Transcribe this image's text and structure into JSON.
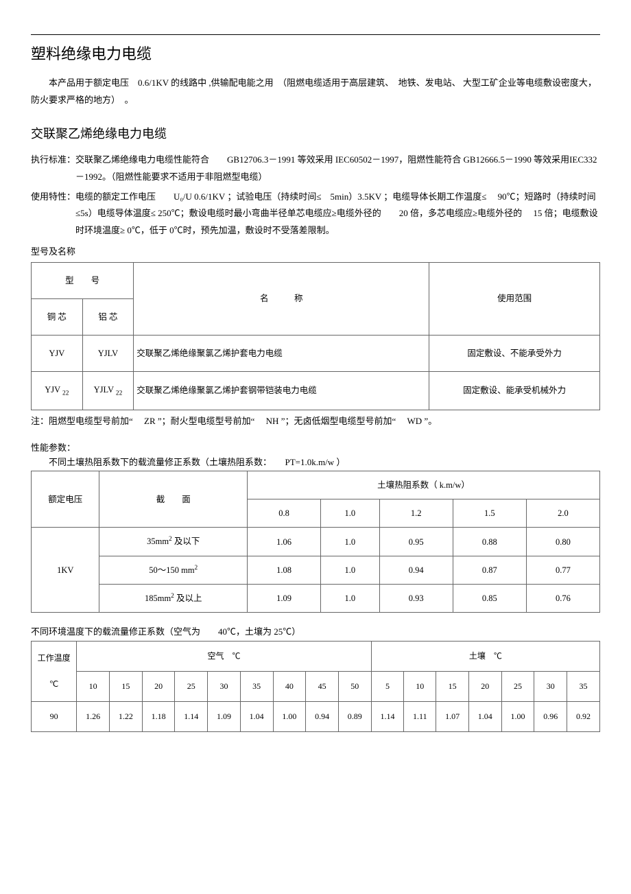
{
  "h1": "塑料绝缘电力电缆",
  "intro": "本产品用于额定电压　0.6/1KV 的线路中 ,供输配电能之用　（阻燃电缆适用于高层建筑、　地铁、发电站、 大型工矿企业等电缆敷设密度大，防火要求严格的地方）　。",
  "h2": "交联聚乙烯绝缘电力电缆",
  "std_label": "执行标准：",
  "std_body": "交联聚乙烯绝缘电力电缆性能符合　　GB12706.3－1991 等效采用  IEC60502－1997，阻燃性能符合   GB12666.5－1990 等效采用IEC332－1992。（阻燃性能要求不适用于非阻燃型电缆）",
  "use_label": "使用特性：",
  "use_body": "电缆的额定工作电压　　U₀/U 0.6/1KV ；试验电压（持续时间≤　5min）3.5KV ；电缆导体长期工作温度≤　 90℃；短路时（持续时间≤5s）电缆导体温度≤  250℃；敷设电缆时最小弯曲半径单芯电缆应≥电缆外径的　　20 倍，多芯电缆应≥电缆外径的　 15 倍；电缆敷设时环境温度≥  0℃，低于  0℃时，预先加温，敷设时不受落差限制。",
  "model_label": "型号及名称",
  "t1": {
    "h_model": "型　　号",
    "h_name": "名　　　称",
    "h_scope": "使用范围",
    "h_cu": "铜 芯",
    "h_al": "铝 芯",
    "rows": [
      {
        "cu": "YJV",
        "al": "YJLV",
        "name": "交联聚乙烯绝缘聚氯乙烯护套电力电缆",
        "scope": "固定敷设、不能承受外力"
      },
      {
        "cu": "YJV 22",
        "al": "YJLV 22",
        "name": "交联聚乙烯绝缘聚氯乙烯护套钢带铠装电力电缆",
        "scope": "固定敷设、能承受机械外力"
      }
    ]
  },
  "t1_note": "注：阻燃型电缆型号前加“　 ZR ”；耐火型电缆型号前加“　 NH ”；无卤低烟型电缆型号前加“　 WD ”。",
  "perf_label": "性能参数：",
  "t2_title": "不同土壤热阻系数下的载流量修正系数（土壤热阻系数：　　PT=1.0k.m/w ）",
  "t2": {
    "h_volt": "额定电压",
    "h_sec": "截　　面",
    "h_coef": "土壤热阻系数（  k.m/w）",
    "cols": [
      "0.8",
      "1.0",
      "1.2",
      "1.5",
      "2.0"
    ],
    "volt": "1KV",
    "rows": [
      {
        "sec": "35mm² 及以下",
        "v": [
          "1.06",
          "1.0",
          "0.95",
          "0.88",
          "0.80"
        ]
      },
      {
        "sec": "50～150 mm²",
        "v": [
          "1.08",
          "1.0",
          "0.94",
          "0.87",
          "0.77"
        ]
      },
      {
        "sec": "185mm² 及以上",
        "v": [
          "1.09",
          "1.0",
          "0.93",
          "0.85",
          "0.76"
        ]
      }
    ]
  },
  "t3_title": "不同环境温度下的载流量修正系数（空气为　　40℃，土壤为  25℃）",
  "t3": {
    "h_temp_a": "工作温度",
    "h_temp_b": "℃",
    "h_air": "空气　℃",
    "h_soil": "土壤　℃",
    "air_cols": [
      "10",
      "15",
      "20",
      "25",
      "30",
      "35",
      "40",
      "45",
      "50"
    ],
    "soil_cols": [
      "5",
      "10",
      "15",
      "20",
      "25",
      "30",
      "35"
    ],
    "row_temp": "90",
    "air_vals": [
      "1.26",
      "1.22",
      "1.18",
      "1.14",
      "1.09",
      "1.04",
      "1.00",
      "0.94",
      "0.89"
    ],
    "soil_vals": [
      "1.14",
      "1.11",
      "1.07",
      "1.04",
      "1.00",
      "0.96",
      "0.92"
    ]
  }
}
